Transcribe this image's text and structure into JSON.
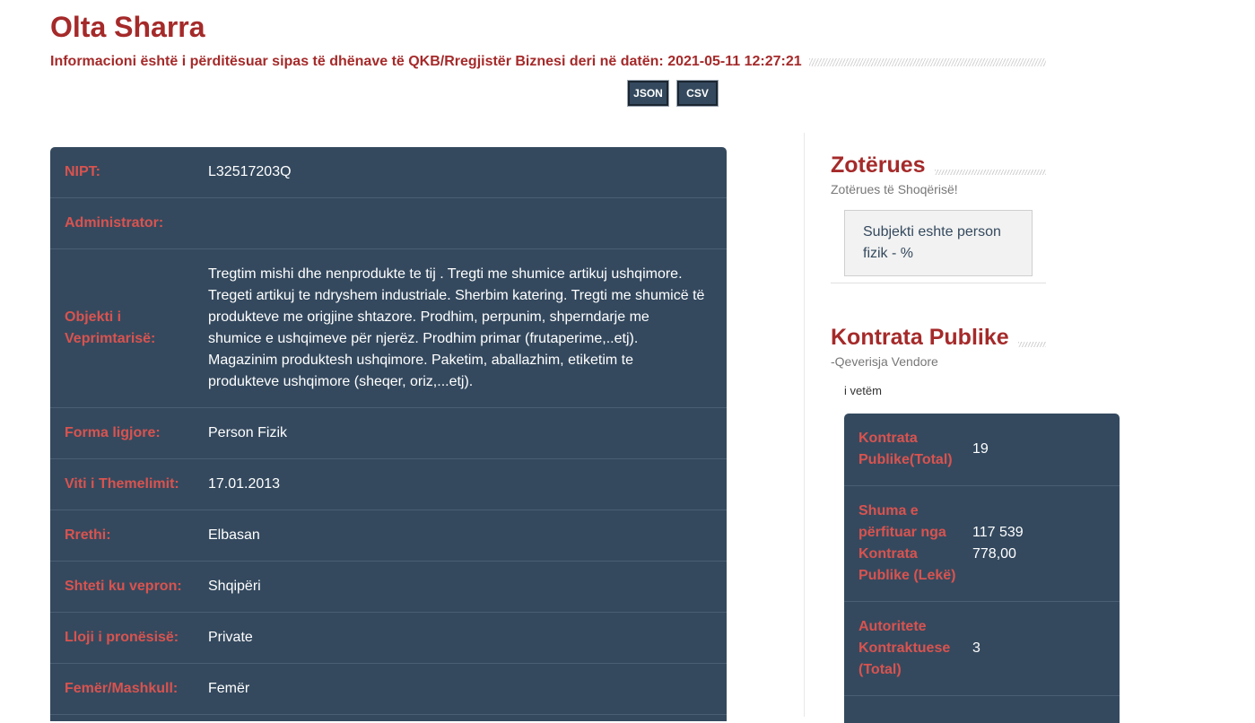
{
  "header": {
    "title": "Olta Sharra",
    "subtitle": "Informacioni është i përditësuar sipas të dhënave të QKB/Rregjistër Biznesi deri në datën: 2021-05-11 12:27:21",
    "buttons": {
      "json": "JSON",
      "csv": "CSV"
    }
  },
  "details": [
    {
      "label": "NIPT:",
      "value": "L32517203Q"
    },
    {
      "label": "Administrator:",
      "value": ""
    },
    {
      "label": "Objekti i Veprimtarisë:",
      "value": "Tregtim mishi dhe nenprodukte te tij . Tregti me shumice artikuj ushqimore. Tregeti artikuj te ndryshem industriale. Sherbim katering. Tregti me shumicë të produkteve me origjine shtazore. Prodhim, perpunim, shperndarje me shumice e ushqimeve për njerëz. Prodhim primar (frutaperime,..etj). Magazinim produktesh ushqimore. Paketim, aballazhim, etiketim te produkteve ushqimore (sheqer, oriz,...etj)."
    },
    {
      "label": "Forma ligjore:",
      "value": "Person Fizik"
    },
    {
      "label": "Viti i Themelimit:",
      "value": "17.01.2013"
    },
    {
      "label": "Rrethi:",
      "value": "Elbasan"
    },
    {
      "label": "Shteti ku vepron:",
      "value": "Shqipëri"
    },
    {
      "label": "Lloji i pronësisë:",
      "value": "Private"
    },
    {
      "label": "Femër/Mashkull:",
      "value": "Femër"
    }
  ],
  "owners": {
    "title": "Zotërues",
    "subtitle": "Zotërues të Shoqërisë!",
    "box_text": "Subjekti eshte person fizik - %"
  },
  "contracts": {
    "title": "Kontrata Publike",
    "subtitle": "-Qeverisja Vendore",
    "note": "i vetëm",
    "stats": [
      {
        "label": "Kontrata Publike(Total)",
        "value": "19"
      },
      {
        "label": "Shuma e përfituar nga Kontrata Publike (Lekë)",
        "value": "117 539 778,00"
      },
      {
        "label": "Autoritete Kontraktuese (Total)",
        "value": "3"
      }
    ]
  }
}
